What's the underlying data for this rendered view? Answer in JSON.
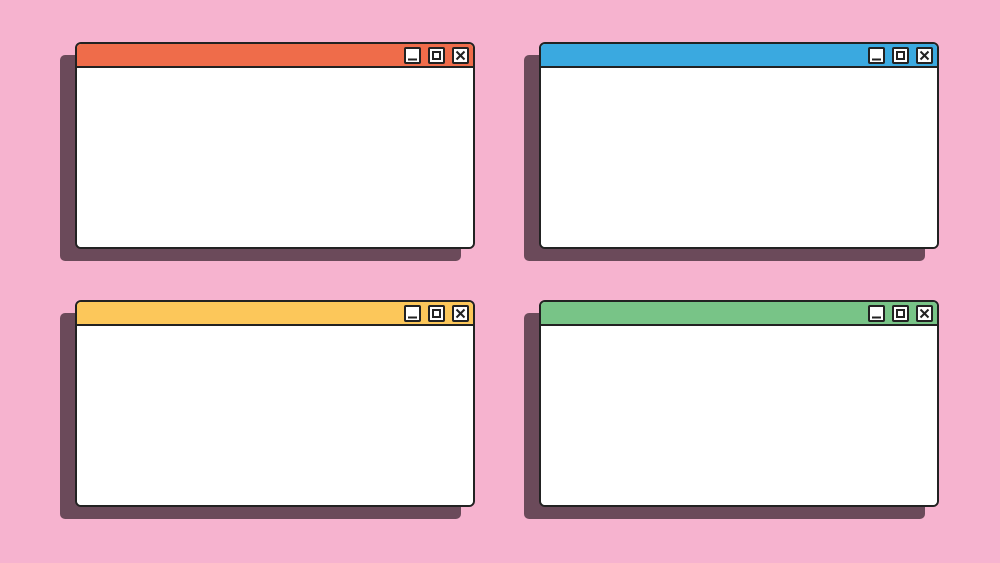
{
  "background_color": "#f6b3cf",
  "shadow_color": "#6b4a5a",
  "border_color": "#222222",
  "content_color": "#ffffff",
  "windows": [
    {
      "titlebar_color": "#ef6c4a",
      "controls": [
        "minimize-icon",
        "maximize-icon",
        "close-icon"
      ]
    },
    {
      "titlebar_color": "#3aa9e0",
      "controls": [
        "minimize-icon",
        "maximize-icon",
        "close-icon"
      ]
    },
    {
      "titlebar_color": "#fcc75a",
      "controls": [
        "minimize-icon",
        "maximize-icon",
        "close-icon"
      ]
    },
    {
      "titlebar_color": "#78c487",
      "controls": [
        "minimize-icon",
        "maximize-icon",
        "close-icon"
      ]
    }
  ]
}
